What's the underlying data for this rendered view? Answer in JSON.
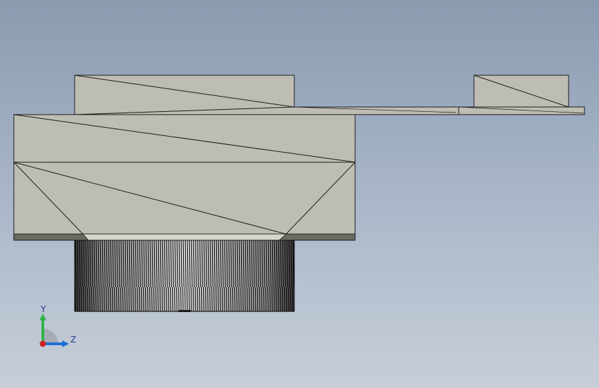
{
  "viewport": {
    "background_top": "#8a9bb0",
    "background_bottom": "#c7ced8"
  },
  "model": {
    "face_color": "#bdbdb3",
    "edge_color": "#1a1a1a",
    "dark_face_color": "#6a6a62",
    "knurl_color": "#111111"
  },
  "triad": {
    "y_label": "Y",
    "z_label": "Z",
    "y_color": "#2fb34a",
    "z_color": "#1f6fd6",
    "x_color": "#d21f1f"
  }
}
